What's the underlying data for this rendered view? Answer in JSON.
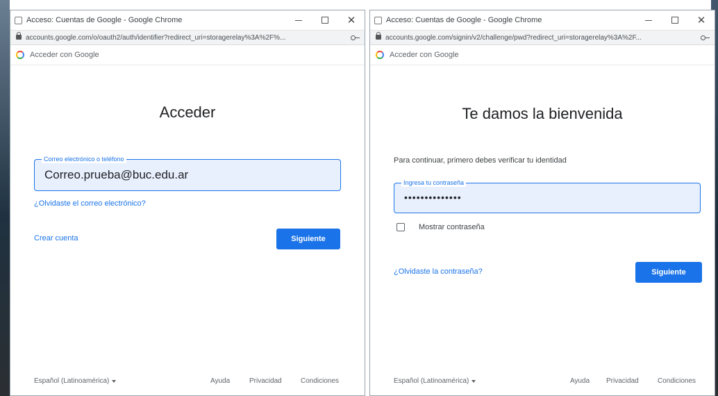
{
  "window_left": {
    "title": "Acceso: Cuentas de Google - Google Chrome",
    "url": "accounts.google.com/o/oauth2/auth/identifier?redirect_uri=storagerelay%3A%2F%...",
    "signin_header": "Acceder con Google",
    "heading": "Acceder",
    "email_field": {
      "label": "Correo electrónico o teléfono",
      "value": "Correo.prueba@buc.edu.ar"
    },
    "forgot_email_link": "¿Olvidaste el correo electrónico?",
    "create_account_link": "Crear cuenta",
    "next_button": "Siguiente",
    "footer": {
      "language": "Español (Latinoamérica)",
      "help": "Ayuda",
      "privacy": "Privacidad",
      "terms": "Condiciones"
    }
  },
  "window_right": {
    "title": "Acceso: Cuentas de Google - Google Chrome",
    "url": "accounts.google.com/signin/v2/challenge/pwd?redirect_uri=storagerelay%3A%2F...",
    "signin_header": "Acceder con Google",
    "heading": "Te damos la bienvenida",
    "info_text": "Para continuar, primero debes verificar tu identidad",
    "password_field": {
      "label": "Ingresa tu contraseña",
      "value": "••••••••••••••"
    },
    "show_password_label": "Mostrar contraseña",
    "forgot_password_link": "¿Olvidaste la contraseña?",
    "next_button": "Siguiente",
    "footer": {
      "language": "Español (Latinoamérica)",
      "help": "Ayuda",
      "privacy": "Privacidad",
      "terms": "Condiciones"
    }
  },
  "window_controls": {
    "minimize": "",
    "maximize": "",
    "close": "✕"
  },
  "colors": {
    "accent": "#1a73e8",
    "field_bg": "#e8f0fe"
  },
  "icons": [
    "chrome-page-icon",
    "lock-icon",
    "key-icon",
    "google-logo-icon",
    "caret-down-icon"
  ]
}
